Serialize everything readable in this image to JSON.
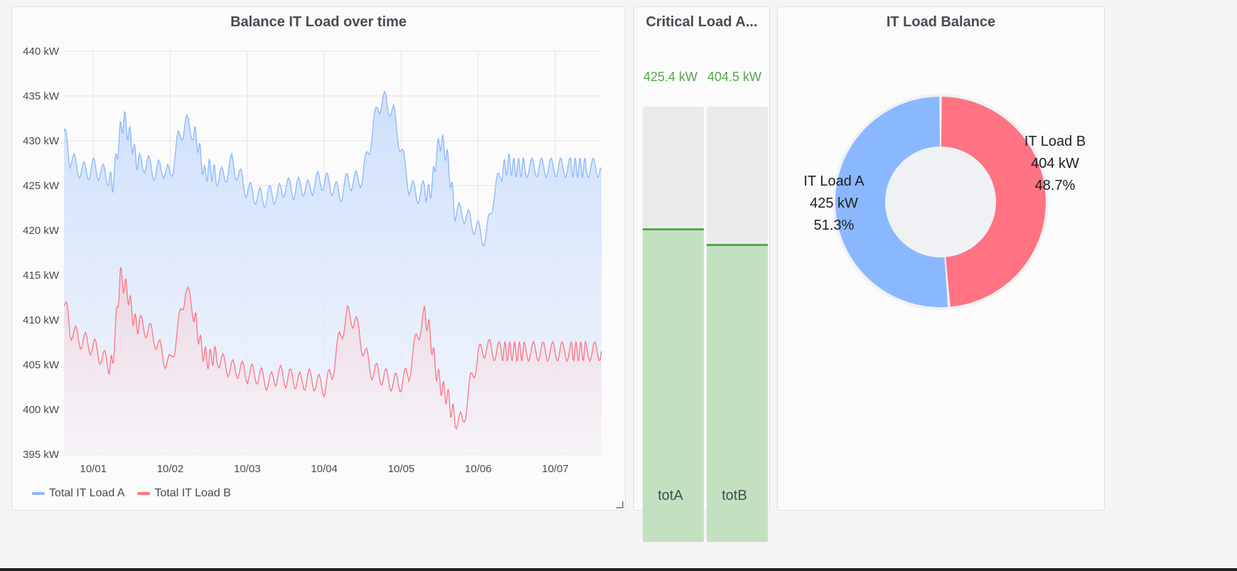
{
  "panels": {
    "timeseries": {
      "title": "Balance IT Load over time",
      "legend": [
        {
          "label": "Total IT Load A",
          "color": "#8ab8ff"
        },
        {
          "label": "Total IT Load B",
          "color": "#ff7383"
        }
      ]
    },
    "bargauge": {
      "title": "Critical Load A...",
      "bars": [
        {
          "label": "totA",
          "value_text": "425.4 kW",
          "fraction": 0.715
        },
        {
          "label": "totB",
          "value_text": "404.5 kW",
          "fraction": 0.68
        }
      ]
    },
    "pie": {
      "title": "IT Load Balance",
      "slices": [
        {
          "name": "IT Load A",
          "value_text": "425 kW",
          "percent_text": "51.3%",
          "percent": 51.3,
          "color": "#8ab8ff"
        },
        {
          "name": "IT Load B",
          "value_text": "404 kW",
          "percent_text": "48.7%",
          "percent": 48.7,
          "color": "#ff7383"
        }
      ]
    }
  },
  "chart_data": {
    "type": "area",
    "title": "Balance IT Load over time",
    "x_ticks": [
      "10/01",
      "10/02",
      "10/03",
      "10/04",
      "10/05",
      "10/06",
      "10/07"
    ],
    "y_ticks": [
      "440 kW",
      "435 kW",
      "430 kW",
      "425 kW",
      "420 kW",
      "415 kW",
      "410 kW",
      "405 kW",
      "400 kW",
      "395 kW"
    ],
    "ylim": [
      395,
      440
    ],
    "xlim": [
      -0.38,
      6.6
    ],
    "grid": true,
    "legend_placement": "bottom-left",
    "series": [
      {
        "name": "Total IT Load A",
        "color": "#8ab8ff",
        "x": [
          -0.38,
          -0.3,
          -0.2,
          -0.1,
          0.0,
          0.1,
          0.2,
          0.25,
          0.3,
          0.35,
          0.4,
          0.45,
          0.5,
          0.55,
          0.6,
          0.7,
          0.8,
          0.9,
          1.0,
          1.1,
          1.2,
          1.3,
          1.35,
          1.4,
          1.45,
          1.5,
          1.55,
          1.6,
          1.7,
          1.8,
          1.9,
          2.0,
          2.1,
          2.2,
          2.3,
          2.4,
          2.5,
          2.6,
          2.7,
          2.8,
          2.9,
          3.0,
          3.1,
          3.2,
          3.3,
          3.4,
          3.5,
          3.6,
          3.7,
          3.8,
          3.9,
          4.0,
          4.1,
          4.2,
          4.3,
          4.35,
          4.4,
          4.45,
          4.5,
          4.55,
          4.6,
          4.65,
          4.7,
          4.8,
          4.9,
          5.0,
          5.1,
          5.2,
          5.3,
          5.35,
          5.4,
          5.45,
          5.5,
          5.55,
          5.6,
          5.7,
          5.8,
          5.9,
          6.0,
          6.1,
          6.2,
          6.25,
          6.3,
          6.35,
          6.4,
          6.5,
          6.6
        ],
        "y": [
          431,
          428,
          427,
          426.5,
          427,
          426.5,
          426,
          425,
          428,
          431,
          432.5,
          431,
          430,
          428,
          427.5,
          427.5,
          426.5,
          427,
          426,
          430,
          432,
          431,
          430,
          428,
          426,
          427,
          426.5,
          426,
          426,
          427.5,
          426,
          424.5,
          424,
          423.5,
          424,
          424,
          425,
          424.5,
          425,
          424.5,
          425.5,
          425.5,
          425,
          424,
          425.5,
          425.5,
          426,
          430,
          434,
          434.5,
          433,
          429,
          425,
          424,
          424.5,
          424,
          425,
          428,
          430,
          429.5,
          428,
          425,
          422,
          422,
          421,
          420,
          419,
          424,
          426.5,
          427,
          427.5,
          427,
          427,
          427,
          427,
          427,
          427,
          427,
          427,
          427,
          427,
          427,
          427,
          427,
          427,
          427,
          427
        ]
      },
      {
        "name": "Total IT Load B",
        "color": "#ff7383",
        "x": [
          -0.38,
          -0.3,
          -0.2,
          -0.1,
          0.0,
          0.1,
          0.2,
          0.25,
          0.3,
          0.35,
          0.4,
          0.45,
          0.5,
          0.55,
          0.6,
          0.7,
          0.8,
          0.9,
          1.0,
          1.1,
          1.2,
          1.3,
          1.35,
          1.4,
          1.45,
          1.5,
          1.55,
          1.6,
          1.7,
          1.8,
          1.9,
          2.0,
          2.1,
          2.2,
          2.3,
          2.4,
          2.5,
          2.6,
          2.7,
          2.8,
          2.9,
          3.0,
          3.1,
          3.2,
          3.3,
          3.4,
          3.5,
          3.6,
          3.7,
          3.8,
          3.9,
          4.0,
          4.1,
          4.2,
          4.3,
          4.35,
          4.4,
          4.45,
          4.5,
          4.55,
          4.6,
          4.65,
          4.7,
          4.8,
          4.9,
          5.0,
          5.1,
          5.2,
          5.3,
          5.35,
          5.4,
          5.45,
          5.5,
          5.55,
          5.6,
          5.7,
          5.8,
          5.9,
          6.0,
          6.1,
          6.2,
          6.25,
          6.3,
          6.35,
          6.4,
          6.5,
          6.6
        ],
        "y": [
          412.5,
          409,
          408,
          407.5,
          407,
          406,
          405,
          405,
          410,
          415,
          414,
          413,
          411,
          409.5,
          409.5,
          409,
          408,
          406,
          405,
          409,
          413.5,
          411,
          409,
          407,
          406,
          405.5,
          406,
          406,
          405,
          404.5,
          404.5,
          404,
          404,
          403.5,
          403,
          404,
          403.5,
          403.5,
          403,
          403.5,
          403,
          402.5,
          404,
          408,
          410.5,
          410,
          407,
          404.5,
          404,
          403.5,
          403,
          403,
          404,
          408,
          410.5,
          409.5,
          407,
          404.5,
          403,
          402,
          401.5,
          400,
          399,
          398.5,
          403,
          406,
          407,
          406.5,
          406.5,
          406.5,
          406.5,
          406.5,
          406.5,
          406.5,
          406.5,
          406.5,
          406.5,
          406.5,
          406.5,
          406.5,
          406.5,
          406.5,
          406.5,
          406.5,
          406.5,
          406.5,
          406.5
        ]
      }
    ]
  }
}
